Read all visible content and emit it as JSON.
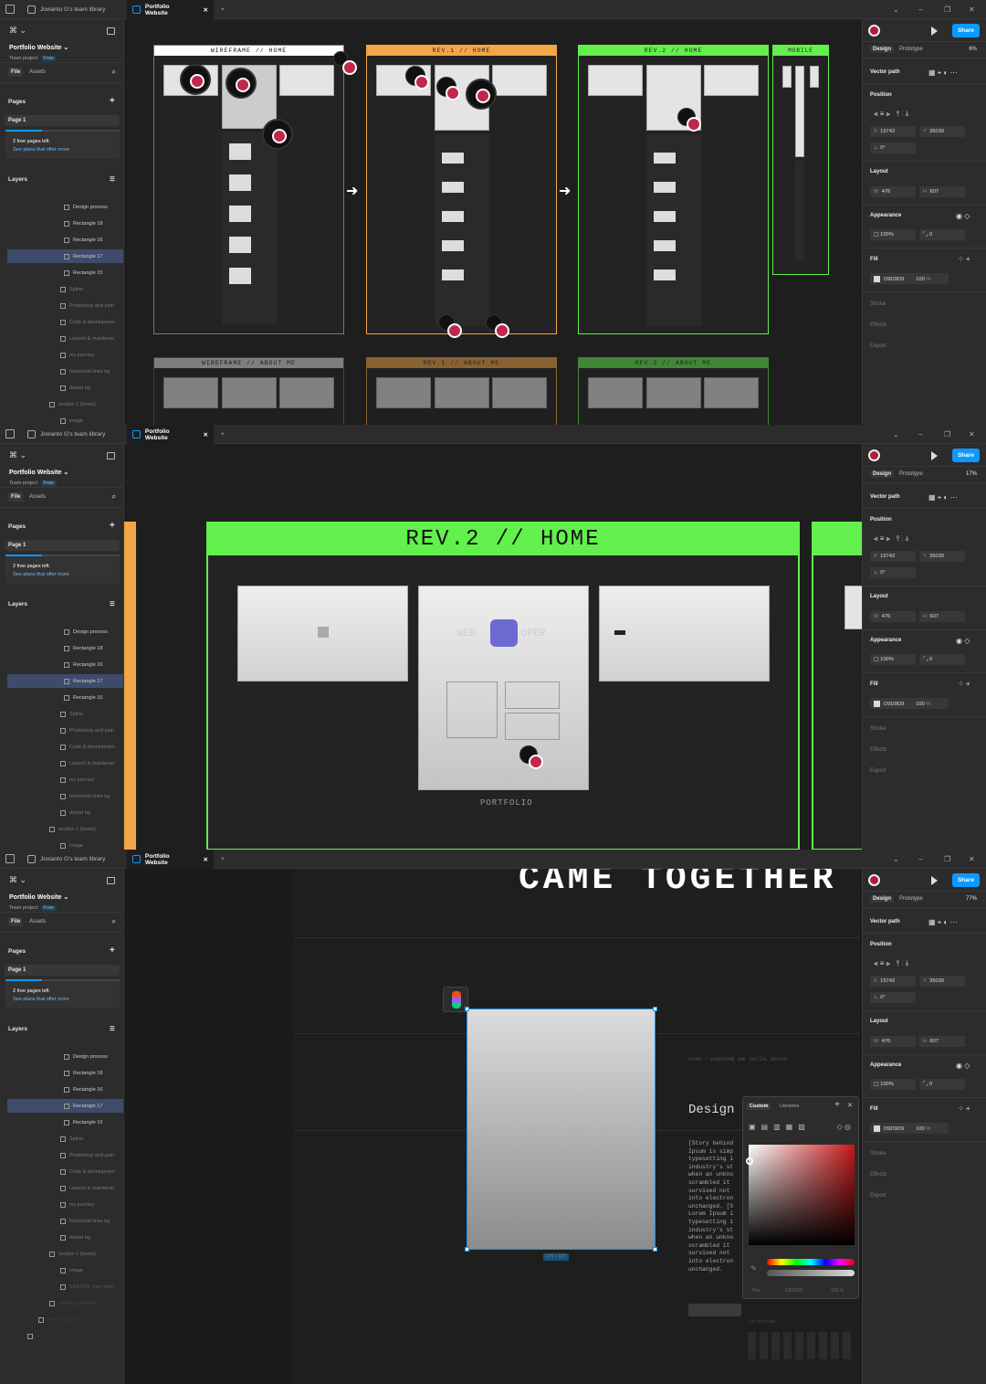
{
  "tabs": {
    "team_library": "Jovianto G's team library",
    "file": "Portfolio Website",
    "add": "+"
  },
  "window": {
    "minimize": "–",
    "restore": "❐",
    "close": "✕",
    "chevron": "⌄"
  },
  "left": {
    "menu": "⌘ ⌄",
    "project_name": "Portfolio Website",
    "project_sub": "Team project",
    "free_badge": "Free",
    "file_tab": "File",
    "assets_tab": "Assets",
    "pages_heading": "Pages",
    "page1": "Page 1",
    "free_pages": "2 free pages left.",
    "plans_link": "See plans that offer more",
    "layers_heading": "Layers",
    "layers": [
      "Design process",
      "Rectangle 18",
      "Rectangle 16",
      "Rectangle 17",
      "Rectangle 15",
      "Spline",
      "Photoshop and pain",
      "Code & developmen",
      "Launch & maintenar",
      "my journey:",
      "horizontal lines bg",
      "darker bg",
      "section 1 (home)",
      "image"
    ],
    "layers_extra": [
      "SKETCH, then wirel",
      "roadmap section",
      "ends bg page",
      "total checks"
    ]
  },
  "right": {
    "design_tab": "Design",
    "prototype_tab": "Prototype",
    "zooms": [
      "6%",
      "17%",
      "77%"
    ],
    "share": "Share",
    "vector_path": "Vector path",
    "position": "Position",
    "x_label": "X",
    "x": "15742",
    "y_label": "Y",
    "y": "35030",
    "rotation": "0°",
    "layout": "Layout",
    "w_label": "W",
    "w": "476",
    "h_label": "H",
    "h": "607",
    "appearance": "Appearance",
    "opacity": "100%",
    "radius": "0",
    "fill": "Fill",
    "fill_hex": "D9D9D9",
    "fill_opacity": "100",
    "fill_pct": "%",
    "stroke": "Stroke",
    "effects": "Effects",
    "export": "Export"
  },
  "canvas1": {
    "frames": [
      "WIREFRAME // HOME",
      "REV.1 // HOME",
      "REV.2 // HOME",
      "MOBILE"
    ],
    "frames_row2": [
      "WIREFRAME // ABOUT ME",
      "REV.1 // ABOUT ME",
      "REV.2 // ABOUT ME"
    ],
    "portfolio": "PORTFOLIO"
  },
  "canvas2": {
    "frame_title": "REV.2 // HOME",
    "portfolio": "PORTFOLIO",
    "web": "WEB",
    "oper": "OPER"
  },
  "canvas3": {
    "headline": "CAME TOGETHER",
    "figma_caption": "FIGMA - WIREFRAME AND INITIAL DESIGN",
    "design_word": "Design",
    "dimension": "476 × 607",
    "story_text": "[Story behind Ipsum is simp typesetting i industry's st when an unkno scrambled it survived not into electron unchanged. [S Lorem Ipsum i typesetting i industry's st when an unkno scrambled it survived not into electron unchanged.",
    "picker_custom": "Custom",
    "picker_libraries": "Libraries",
    "picker_hex_label": "Hex",
    "picker_hex": "D9D9D9",
    "picker_pct": "100 %",
    "picker_file": "On this page"
  },
  "colors": {
    "accent": "#0d99ff",
    "green": "#62f04c",
    "orange": "#f4a548",
    "white": "#ffffff",
    "selection": "#3e4b6b"
  }
}
